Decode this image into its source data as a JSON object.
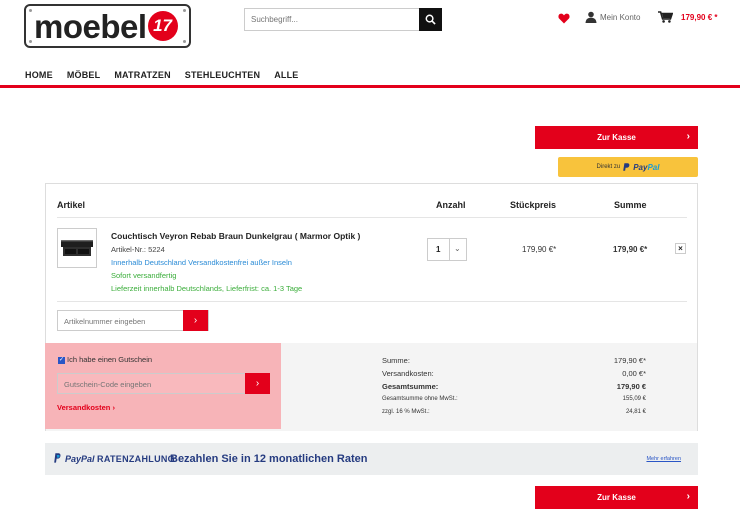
{
  "header": {
    "logo_text": "moebel",
    "logo_badge": "17",
    "search_placeholder": "Suchbegriff...",
    "account_label": "Mein Konto",
    "cart_total": "179,90 € *"
  },
  "nav": [
    "HOME",
    "MÖBEL",
    "MATRATZEN",
    "STEHLEUCHTEN",
    "ALLE"
  ],
  "buttons": {
    "checkout_label": "Zur Kasse",
    "paypal_direct": "Direkt zu",
    "paypal_brand_pay": "Pay",
    "paypal_brand_pal": "Pal"
  },
  "table": {
    "headers": {
      "article": "Artikel",
      "quantity": "Anzahl",
      "unit_price": "Stückpreis",
      "total": "Summe"
    },
    "items": [
      {
        "title": "Couchtisch Veyron Rebab Braun Dunkelgrau ( Marmor Optik )",
        "article_no": "Artikel-Nr.: 5224",
        "shipping_note": "Innerhalb Deutschland Versandkostenfrei außer Inseln",
        "availability": "Sofort versandfertig",
        "delivery": "Lieferzeit innerhalb Deutschlands, Lieferfrist: ca. 1-3 Tage",
        "quantity": "1",
        "unit_price": "179,90 €*",
        "total": "179,90 €*",
        "remove": "×"
      }
    ],
    "article_number_placeholder": "Artikelnummer eingeben"
  },
  "voucher": {
    "checkbox_label": "Ich habe einen Gutschein",
    "code_placeholder": "Gutschein-Code eingeben",
    "shipping_link": "Versandkosten"
  },
  "summary": {
    "rows": [
      {
        "label": "Summe:",
        "value": "179,90 €*"
      },
      {
        "label": "Versandkosten:",
        "value": "0,00 €*"
      },
      {
        "label": "Gesamtsumme:",
        "value": "179,90 €"
      },
      {
        "label": "Gesamtsumme ohne MwSt.:",
        "value": "155,09 €"
      },
      {
        "label": "zzgl. 16 % MwSt.:",
        "value": "24,81 €"
      }
    ]
  },
  "ratenzahlung": {
    "logo_pay": "PayPal",
    "logo_rz": "RATENZAHLUNG",
    "text": "Bezahlen Sie in 12 monatlichen Raten",
    "more_link": "Mehr erfahren"
  },
  "colors": {
    "accent": "#e3001b",
    "paypal_yellow": "#f8c33c",
    "paypal_blue": "#253b80"
  }
}
